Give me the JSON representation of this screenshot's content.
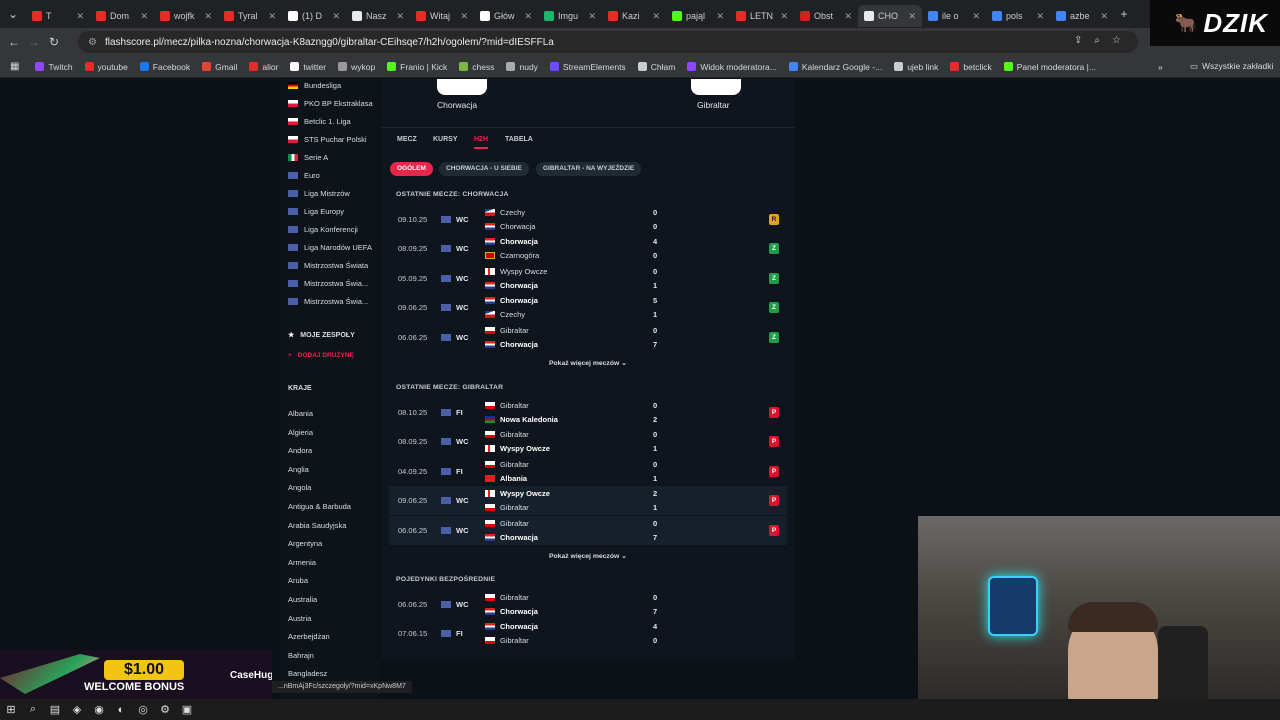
{
  "tabs": [
    {
      "label": "T",
      "color": "#e52d27"
    },
    {
      "label": "Dom",
      "color": "#e52d27"
    },
    {
      "label": "wojfk",
      "color": "#e52d27"
    },
    {
      "label": "Tyral",
      "color": "#e52d27"
    },
    {
      "label": "(1) D",
      "color": "#ffffff"
    },
    {
      "label": "Nasz",
      "color": "#e8eaed"
    },
    {
      "label": "Witaj",
      "color": "#e52d27"
    },
    {
      "label": "Głów",
      "color": "#ffffff"
    },
    {
      "label": "Imgu",
      "color": "#1bb76e"
    },
    {
      "label": "Kazi",
      "color": "#e52d27"
    },
    {
      "label": "pająl",
      "color": "#53fc18"
    },
    {
      "label": "LETN",
      "color": "#e52d27"
    },
    {
      "label": "Obst",
      "color": "#cc2222"
    },
    {
      "label": "CHO",
      "color": "#e8eaed"
    },
    {
      "label": "ile o",
      "color": "#4285f4"
    },
    {
      "label": "pols",
      "color": "#4285f4"
    },
    {
      "label": "azbe",
      "color": "#4285f4"
    }
  ],
  "url": "flashscore.pl/mecz/pilka-nozna/chorwacja-K8azngg0/gibraltar-CEihsqe7/h2h/ogolem/?mid=dIESFFLa",
  "bookmarks": [
    "Twitch",
    "youtube",
    "Facebook",
    "Gmail",
    "alior",
    "twitter",
    "wykop",
    "Franio | Kick",
    "chess",
    "nudy",
    "StreamElements",
    "Chłam",
    "Widok moderatora...",
    "Kalendarz Google -...",
    "ujeb link",
    "betclick",
    "Panel moderatora |..."
  ],
  "bookmarks_all": "Wszystkie zakładki",
  "watermark": "DZIK",
  "sidebar": {
    "leagues": [
      {
        "name": "Bundesliga",
        "flag": "de"
      },
      {
        "name": "PKO BP Ekstraklasa",
        "flag": "pl"
      },
      {
        "name": "Betclic 1. Liga",
        "flag": "pl"
      },
      {
        "name": "STS Puchar Polski",
        "flag": "pl"
      },
      {
        "name": "Serie A",
        "flag": "it"
      },
      {
        "name": "Euro",
        "flag": "eu"
      },
      {
        "name": "Liga Mistrzów",
        "flag": "eu"
      },
      {
        "name": "Liga Europy",
        "flag": "eu"
      },
      {
        "name": "Liga Konferencji",
        "flag": "eu"
      },
      {
        "name": "Liga Narodów UEFA",
        "flag": "eu"
      },
      {
        "name": "Mistrzostwa Świata",
        "flag": "eu"
      },
      {
        "name": "Mistrzostwa Świa...",
        "flag": "eu"
      },
      {
        "name": "Mistrzostwa Świa...",
        "flag": "eu"
      }
    ],
    "my_teams": "MOJE ZESPOŁY",
    "add_team": "DODAJ DRUŻYNĘ",
    "countries_title": "KRAJE",
    "countries": [
      "Albania",
      "Algieria",
      "Andora",
      "Anglia",
      "Angola",
      "Antigua & Barbuda",
      "Arabia Saudyjska",
      "Argentyna",
      "Armenia",
      "Aruba",
      "Australia",
      "Austria",
      "Azerbejdżan",
      "Bahrajn",
      "Bangladesz"
    ]
  },
  "match": {
    "home": "Chorwacja",
    "away": "Gibraltar"
  },
  "nav_tabs": [
    "MECZ",
    "KURSY",
    "H2H",
    "TABELA"
  ],
  "filters": [
    "OGÓLEM",
    "CHORWACJA - U SIEBIE",
    "GIBRALTAR - NA WYJEŹDZIE"
  ],
  "sections": [
    {
      "title": "OSTATNIE MECZE: CHORWACJA",
      "rows": [
        {
          "date": "09.10.25",
          "comp": "WC",
          "t1": "Czechy",
          "f1": "cz",
          "t2": "Chorwacja",
          "f2": "hr",
          "s1": "0",
          "s2": "0",
          "res": "R",
          "b1": false,
          "b2": false
        },
        {
          "date": "08.09.25",
          "comp": "WC",
          "t1": "Chorwacja",
          "f1": "hr",
          "t2": "Czarnogóra",
          "f2": "me",
          "s1": "4",
          "s2": "0",
          "res": "Z",
          "b1": true,
          "b2": false
        },
        {
          "date": "05.09.25",
          "comp": "WC",
          "t1": "Wyspy Owcze",
          "f1": "fo",
          "t2": "Chorwacja",
          "f2": "hr",
          "s1": "0",
          "s2": "1",
          "res": "Z",
          "b1": false,
          "b2": true
        },
        {
          "date": "09.06.25",
          "comp": "WC",
          "t1": "Chorwacja",
          "f1": "hr",
          "t2": "Czechy",
          "f2": "cz",
          "s1": "5",
          "s2": "1",
          "res": "Z",
          "b1": true,
          "b2": false
        },
        {
          "date": "06.06.25",
          "comp": "WC",
          "t1": "Gibraltar",
          "f1": "gi",
          "t2": "Chorwacja",
          "f2": "hr",
          "s1": "0",
          "s2": "7",
          "res": "Z",
          "b1": false,
          "b2": true
        }
      ],
      "more": "Pokaż więcej meczów"
    },
    {
      "title": "OSTATNIE MECZE: GIBRALTAR",
      "rows": [
        {
          "date": "08.10.25",
          "comp": "FI",
          "t1": "Gibraltar",
          "f1": "gi",
          "t2": "Nowa Kaledonia",
          "f2": "nc",
          "s1": "0",
          "s2": "2",
          "res": "P",
          "b1": false,
          "b2": true
        },
        {
          "date": "08.09.25",
          "comp": "WC",
          "t1": "Gibraltar",
          "f1": "gi",
          "t2": "Wyspy Owcze",
          "f2": "fo",
          "s1": "0",
          "s2": "1",
          "res": "P",
          "b1": false,
          "b2": true
        },
        {
          "date": "04.09.25",
          "comp": "FI",
          "t1": "Gibraltar",
          "f1": "gi",
          "t2": "Albania",
          "f2": "al",
          "s1": "0",
          "s2": "1",
          "res": "P",
          "b1": false,
          "b2": true
        },
        {
          "date": "09.06.25",
          "comp": "WC",
          "t1": "Wyspy Owcze",
          "f1": "fo",
          "t2": "Gibraltar",
          "f2": "gi",
          "s1": "2",
          "s2": "1",
          "res": "P",
          "b1": true,
          "b2": false
        },
        {
          "date": "06.06.25",
          "comp": "WC",
          "t1": "Gibraltar",
          "f1": "gi",
          "t2": "Chorwacja",
          "f2": "hr",
          "s1": "0",
          "s2": "7",
          "res": "P",
          "b1": false,
          "b2": true
        }
      ],
      "more": "Pokaż więcej meczów"
    },
    {
      "title": "POJEDYNKI BEZPOŚREDNIE",
      "rows": [
        {
          "date": "06.06.25",
          "comp": "WC",
          "t1": "Gibraltar",
          "f1": "gi",
          "t2": "Chorwacja",
          "f2": "hr",
          "s1": "0",
          "s2": "7",
          "res": "",
          "b1": false,
          "b2": true
        },
        {
          "date": "07.06.15",
          "comp": "FI",
          "t1": "Chorwacja",
          "f1": "hr",
          "t2": "Gibraltar",
          "f2": "gi",
          "s1": "4",
          "s2": "0",
          "res": "",
          "b1": true,
          "b2": false
        }
      ],
      "more": ""
    }
  ],
  "status_url": "...nBmAj3Fc/szczegoly/?mid=xKpNw8M7",
  "ad": {
    "amount": "$1.00",
    "text": "WELCOME BONUS",
    "brand": "CaseHug"
  },
  "colors": {
    "accent": "#e8254b",
    "win": "#1f9d4a",
    "draw": "#e3a321",
    "loss": "#d8142e"
  }
}
